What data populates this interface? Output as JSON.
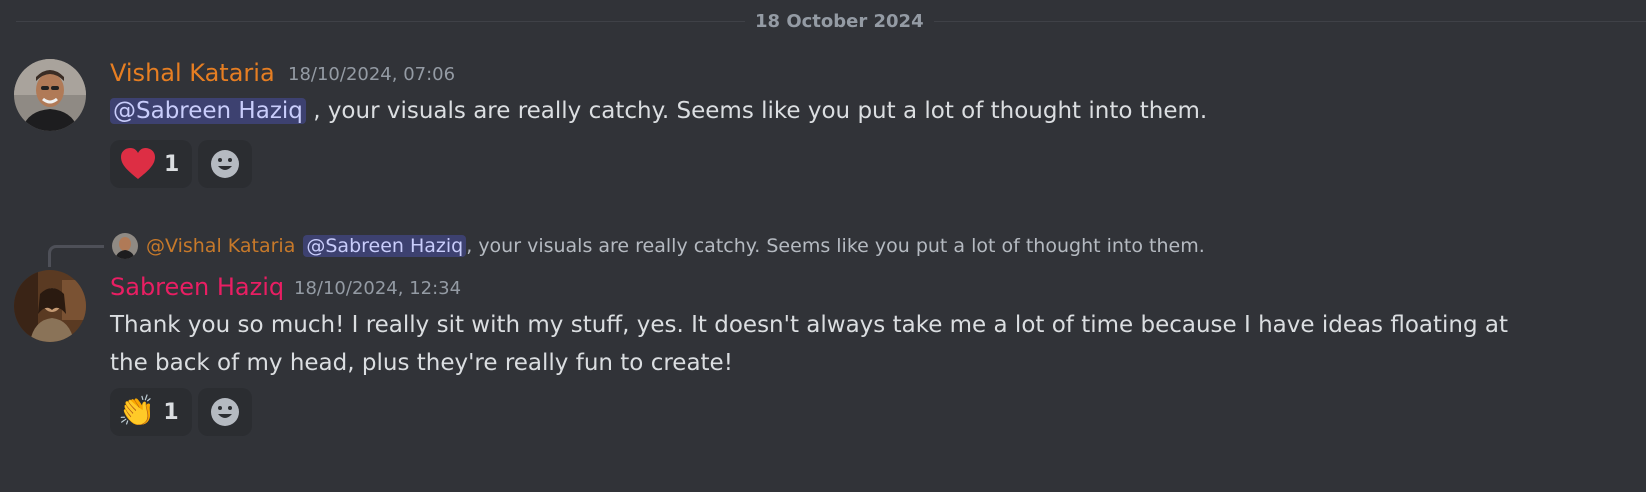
{
  "date_divider": "18 October 2024",
  "colors": {
    "background": "#313338",
    "vishal_name": "#e67e22",
    "sabreen_name": "#e91e63",
    "mention_bg": "#3c4270",
    "reaction_bg": "#2b2d31"
  },
  "messages": [
    {
      "author": "Vishal Kataria",
      "timestamp": "18/10/2024, 07:06",
      "mention": "@Sabreen Haziq",
      "text": ", your visuals are really catchy. Seems like you put a lot of thought into them.",
      "reaction": {
        "emoji": "heart",
        "count": "1"
      }
    },
    {
      "reply_to": {
        "author": "@Vishal Kataria",
        "mention": "@Sabreen Haziq",
        "text": ", your visuals are really catchy. Seems like you put a lot of thought into them."
      },
      "author": "Sabreen Haziq",
      "timestamp": "18/10/2024, 12:34",
      "text": "Thank you so much! I really sit with my stuff, yes. It doesn't always take me a lot of time because I have ideas floating at the back of my head, plus they're really fun to create!",
      "reaction": {
        "emoji": "clapping-hands",
        "count": "1"
      }
    }
  ]
}
